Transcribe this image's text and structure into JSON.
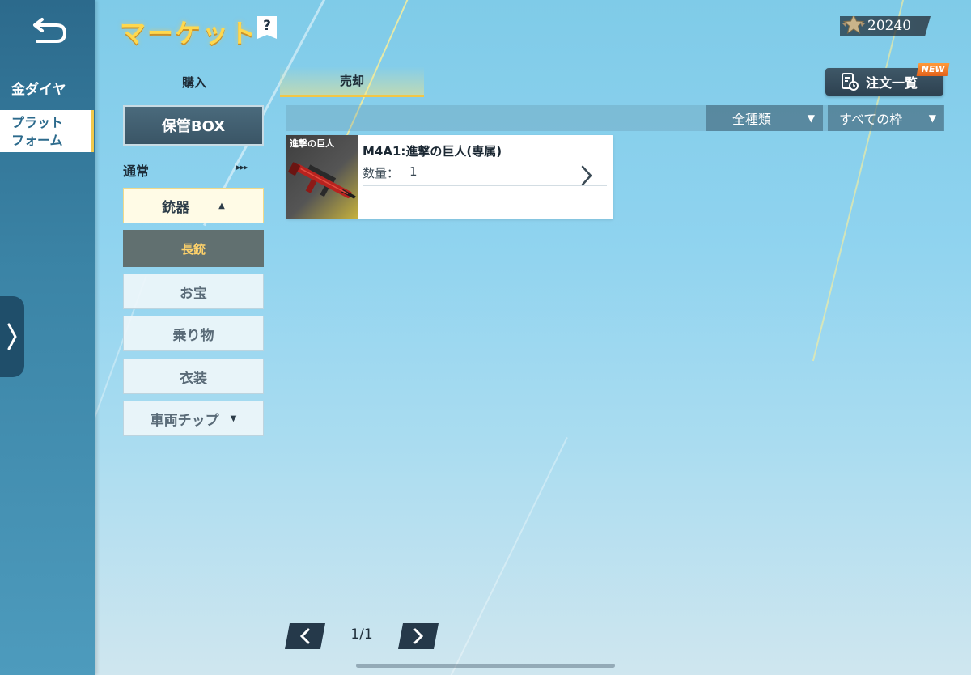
{
  "header": {
    "title": "マーケット",
    "help_icon": "?",
    "currency_value": "20240"
  },
  "left_nav": {
    "items": [
      {
        "label": "金ダイヤ"
      },
      {
        "label": "プラット\nフォーム",
        "selected": true
      }
    ]
  },
  "tabs": [
    {
      "label": "購入"
    },
    {
      "label": "売却",
      "selected": true
    }
  ],
  "orders_button": {
    "label": "注文一覧",
    "badge": "NEW"
  },
  "sidebar": {
    "storage_button": "保管BOX",
    "section_label": "通常",
    "section_arrows": "▸▸▸",
    "categories": [
      {
        "label": "銃器",
        "expanded": true
      },
      {
        "label": "長銃",
        "selected": true
      },
      {
        "label": "お宝"
      },
      {
        "label": "乗り物"
      },
      {
        "label": "衣装"
      },
      {
        "label": "車両チップ"
      }
    ]
  },
  "filters": {
    "kind": "全種類",
    "slot": "すべての枠"
  },
  "items": [
    {
      "name": "M4A1:進撃の巨人(専属)",
      "quantity_label": "数量：",
      "quantity": "1",
      "thumb_logo": "進撃の巨人"
    }
  ],
  "pager": {
    "indicator": "1/1"
  },
  "colors": {
    "title": "#ffd84d",
    "accent": "#f3c646",
    "nav_bg": "#2c6a8c",
    "selected_category": "#617070"
  },
  "icons": {
    "back": "back-arrow-icon",
    "help": "question-icon",
    "currency": "star-badge-icon",
    "orders": "document-clock-icon",
    "handle": "chevron-right-icon",
    "item": "chevron-right-icon",
    "prev": "chevron-left-icon",
    "next": "chevron-right-icon"
  }
}
